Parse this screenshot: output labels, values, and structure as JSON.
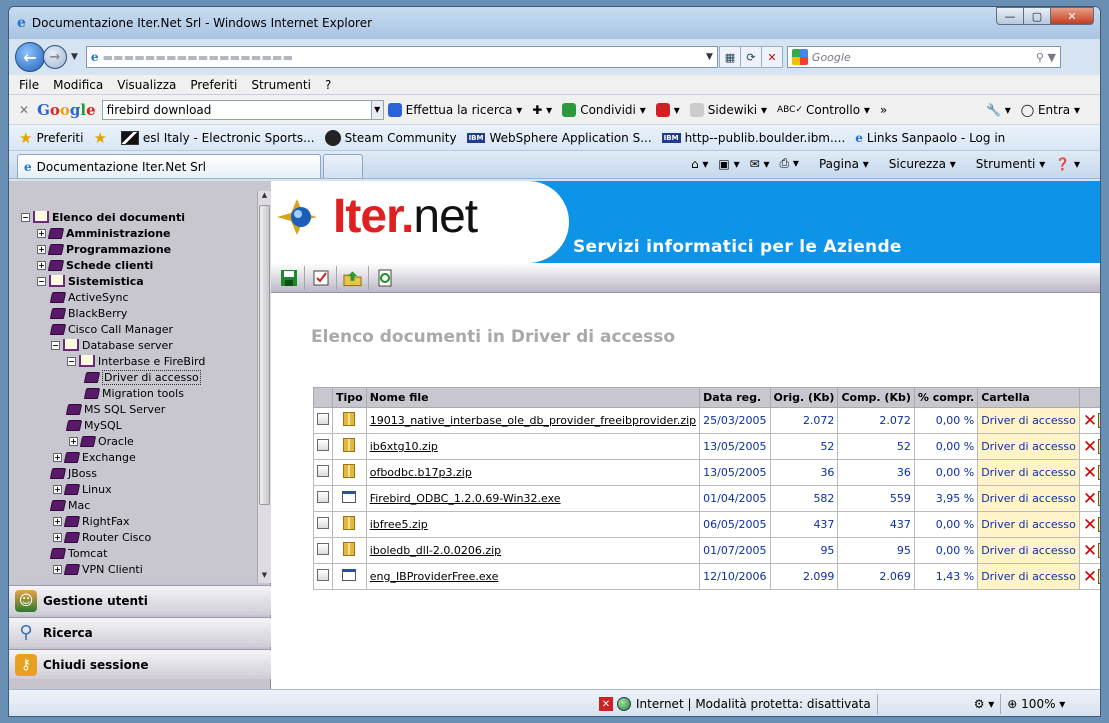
{
  "window": {
    "title": "Documentazione Iter.Net Srl - Windows Internet Explorer"
  },
  "address": {
    "search_placeholder": "Google"
  },
  "menu": [
    "File",
    "Modifica",
    "Visualizza",
    "Preferiti",
    "Strumenti",
    "?"
  ],
  "google_toolbar": {
    "query": "firebird download",
    "search_btn": "Effettua la ricerca",
    "share": "Condividi",
    "sidewiki": "Sidewiki",
    "check": "Controllo",
    "more": "»",
    "signin": "Entra"
  },
  "favorites": {
    "label": "Preferiti",
    "items": [
      "esl Italy - Electronic Sports...",
      "Steam Community",
      "WebSphere Application S...",
      "http--publib.boulder.ibm....",
      "Links Sanpaolo - Log in"
    ]
  },
  "tab": {
    "title": "Documentazione Iter.Net Srl"
  },
  "commandbar": {
    "page": "Pagina",
    "security": "Sicurezza",
    "tools": "Strumenti"
  },
  "tree": {
    "root": "Elenco dei documenti",
    "n1": "Amministrazione",
    "n2": "Programmazione",
    "n3": "Schede clienti",
    "n4": "Sistemistica",
    "n5": "ActiveSync",
    "n6": "BlackBerry",
    "n7": "Cisco Call Manager",
    "n8": "Database server",
    "n9": "Interbase e FireBird",
    "n10": "Driver di accesso",
    "n11": "Migration tools",
    "n12": "MS SQL Server",
    "n13": "MySQL",
    "n14": "Oracle",
    "n15": "Exchange",
    "n16": "JBoss",
    "n17": "Linux",
    "n18": "Mac",
    "n19": "RightFax",
    "n20": "Router Cisco",
    "n21": "Tomcat",
    "n22": "VPN Clienti"
  },
  "sidenav": {
    "users": "Gestione utenti",
    "search": "Ricerca",
    "logout": "Chiudi sessione"
  },
  "banner": {
    "logo_iter": "Iter",
    "logo_dot": ".",
    "logo_net": "net",
    "tagline": "Servizi informatici per le Aziende"
  },
  "main": {
    "heading": "Elenco documenti in Driver di accesso"
  },
  "table": {
    "headers": [
      "Tipo",
      "Nome file",
      "Data reg.",
      "Orig. (Kb)",
      "Comp. (Kb)",
      "% compr.",
      "Cartella"
    ],
    "rows": [
      {
        "name": "19013_native_interbase_ole_db_provider_freeibprovider.zip",
        "date": "25/03/2005",
        "orig": "2.072",
        "comp": "2.072",
        "pct": "0,00 %",
        "folder": "Driver di accesso",
        "type": "zip"
      },
      {
        "name": "ib6xtg10.zip",
        "date": "13/05/2005",
        "orig": "52",
        "comp": "52",
        "pct": "0,00 %",
        "folder": "Driver di accesso",
        "type": "zip"
      },
      {
        "name": "ofbodbc.b17p3.zip",
        "date": "13/05/2005",
        "orig": "36",
        "comp": "36",
        "pct": "0,00 %",
        "folder": "Driver di accesso",
        "type": "zip"
      },
      {
        "name": "Firebird_ODBC_1.2.0.69-Win32.exe",
        "date": "01/04/2005",
        "orig": "582",
        "comp": "559",
        "pct": "3,95 %",
        "folder": "Driver di accesso",
        "type": "exe"
      },
      {
        "name": "ibfree5.zip",
        "date": "06/05/2005",
        "orig": "437",
        "comp": "437",
        "pct": "0,00 %",
        "folder": "Driver di accesso",
        "type": "zip"
      },
      {
        "name": "iboledb_dll-2.0.0206.zip",
        "date": "01/07/2005",
        "orig": "95",
        "comp": "95",
        "pct": "0,00 %",
        "folder": "Driver di accesso",
        "type": "zip"
      },
      {
        "name": "eng_IBProviderFree.exe",
        "date": "12/10/2006",
        "orig": "2.099",
        "comp": "2.069",
        "pct": "1,43 %",
        "folder": "Driver di accesso",
        "type": "exe"
      }
    ]
  },
  "status": {
    "zone": "Internet | Modalità protetta: disattivata",
    "zoom": "100%"
  }
}
